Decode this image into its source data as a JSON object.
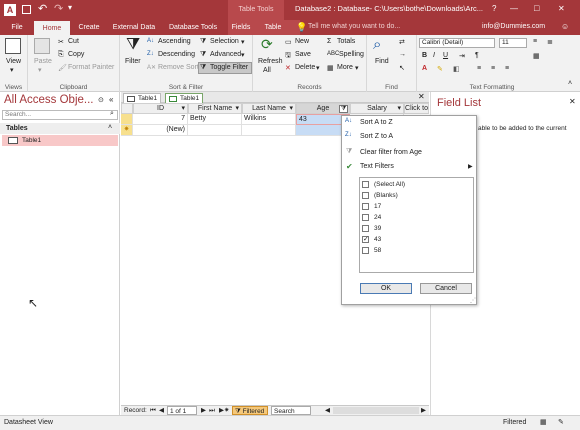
{
  "title_bar": {
    "context_header": "Table Tools",
    "document": "Database2 : Database- C:\\Users\\bothe\\Downloads\\Arc...",
    "help": "?",
    "minimize": "—",
    "restore": "□",
    "close": "✕"
  },
  "tabs": [
    "File",
    "Home",
    "Create",
    "External Data",
    "Database Tools",
    "Fields",
    "Table"
  ],
  "tell_me": "Tell me what you want to do...",
  "account": "info@Dummies.com",
  "ribbon": {
    "views": {
      "view": "View",
      "group": "Views"
    },
    "clipboard": {
      "paste": "Paste",
      "cut": "Cut",
      "copy": "Copy",
      "format_painter": "Format Painter",
      "group": "Clipboard"
    },
    "sort_filter": {
      "filter": "Filter",
      "ascending": "Ascending",
      "descending": "Descending",
      "remove_sort": "Remove Sort",
      "selection": "Selection",
      "advanced": "Advanced",
      "toggle_filter": "Toggle Filter",
      "group": "Sort & Filter"
    },
    "records": {
      "refresh": "Refresh",
      "refresh_sub": "All",
      "new": "New",
      "save": "Save",
      "delete": "Delete",
      "totals": "Totals",
      "spelling": "Spelling",
      "more": "More",
      "group": "Records"
    },
    "find": {
      "find": "Find",
      "group": "Find"
    },
    "text_formatting": {
      "font": "Calibri (Detail)",
      "size": "11",
      "group": "Text Formatting"
    }
  },
  "nav": {
    "title": "All Access Obje...",
    "search_placeholder": "Search...",
    "section": "Tables",
    "items": [
      "Table1"
    ]
  },
  "doc_tabs": [
    "Table1",
    "Table1"
  ],
  "grid": {
    "columns": [
      "ID",
      "First Name",
      "Last Name",
      "Age",
      "Salary",
      "Click to"
    ],
    "rows": [
      {
        "id": "7",
        "first": "Betty",
        "last": "Wilkins",
        "age": "43",
        "salary": ""
      },
      {
        "id": "(New)",
        "first": "",
        "last": "",
        "age": "",
        "salary": ""
      }
    ]
  },
  "record_bar": {
    "label": "Record:",
    "position": "1 of 1",
    "filtered": "Filtered",
    "search": "Search"
  },
  "field_list": {
    "title": "Field List",
    "text": "able to be added to the current"
  },
  "filter_popup": {
    "sort_asc": "Sort A to Z",
    "sort_desc": "Sort Z to A",
    "clear": "Clear filter from Age",
    "text_filters": "Text Filters",
    "values": [
      {
        "label": "(Select All)",
        "checked": false
      },
      {
        "label": "(Blanks)",
        "checked": false
      },
      {
        "label": "17",
        "checked": false
      },
      {
        "label": "24",
        "checked": false
      },
      {
        "label": "39",
        "checked": false
      },
      {
        "label": "43",
        "checked": true
      },
      {
        "label": "58",
        "checked": false
      }
    ],
    "ok": "OK",
    "cancel": "Cancel"
  },
  "status": {
    "left": "Datasheet View",
    "right": "Filtered"
  },
  "colors": {
    "accent": "#a4373a",
    "selected_nav": "#f8c8c8",
    "age_cell": "#c7dcf5"
  }
}
